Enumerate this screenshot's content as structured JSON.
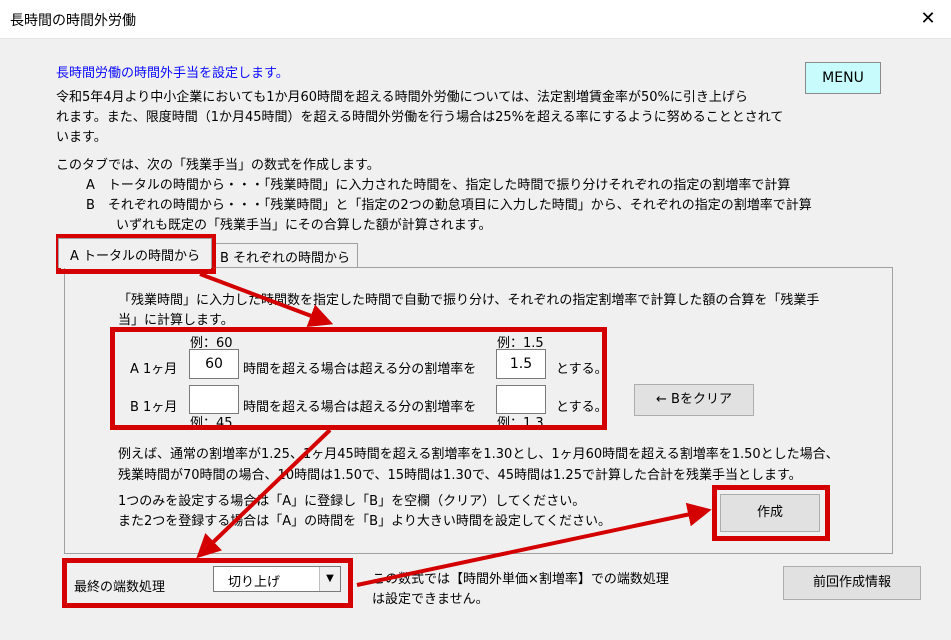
{
  "window": {
    "title": "長時間の時間外労働",
    "close": "✕"
  },
  "intro": {
    "heading": "長時間労働の時間外手当を設定します。",
    "line1": "令和5年4月より中小企業においても1か月60時間を超える時間外労働については、法定割増賃金率が50%に引き上げら",
    "line2": "れます。また、限度時間（1か月45時間）を超える時間外労働を行う場合は25%を超える率にするように努めることとされて",
    "line3": "います。"
  },
  "menu_label": "MENU",
  "description": {
    "line1": "このタブでは、次の「残業手当」の数式を作成します。",
    "line2": "A　トータルの時間から・・・「残業時間」に入力された時間を、指定した時間で振り分けそれぞれの指定の割増率で計算",
    "line3": "B　それぞれの時間から・・・「残業時間」と「指定の2つの勤怠項目に入力した時間」から、それぞれの指定の割増率で計算",
    "line4": "いずれも既定の「残業手当」にその合算した額が計算されます。"
  },
  "tabs": {
    "a": "A トータルの時間から",
    "b": "B  それぞれの時間から"
  },
  "panel": {
    "intro1": "「残業時間」に入力した時間数を指定した時間で自動で振り分け、それぞれの指定割増率で計算した額の合算を「残業手",
    "intro2": "当」に計算します。",
    "example_hours_a": "例：60",
    "example_rate_a": "例：1.5",
    "example_hours_b": "例：45",
    "example_rate_b": "例：1.3",
    "row_a_label": "A 1ヶ月",
    "row_b_label": "B 1ヶ月",
    "row_text": "時間を超える場合は超える分の割増率を",
    "suffix": "とする。",
    "a_hours": "60",
    "a_rate": "1.5",
    "b_hours": "",
    "b_rate": "",
    "clear_b": "← Bをクリア",
    "example1": "例えば、通常の割増率が1.25、1ヶ月45時間を超える割増率を1.30とし、1ヶ月60時間を超える割増率を1.50とした場合、",
    "example2": "残業時間が70時間の場合、10時間は1.50で、15時間は1.30で、45時間は1.25で計算した合計を残業手当とします。",
    "note1": "1つのみを設定する場合は「A」に登録し「B」を空欄（クリア）してください。",
    "note2": "また2つを登録する場合は「A」の時間を「B」より大きい時間を設定してください。",
    "create": "作成"
  },
  "rounding": {
    "label": "最終の端数処理",
    "value": "切り上げ",
    "arrow": "▼",
    "note1": "この数式では【時間外単価×割増率】での端数処理",
    "note2": "は設定できません。"
  },
  "prev_info": "前回作成情報",
  "colors": {
    "annotation_red": "#d40000",
    "heading_blue": "#0a0aff",
    "menu_bg": "#c8fcfc"
  }
}
